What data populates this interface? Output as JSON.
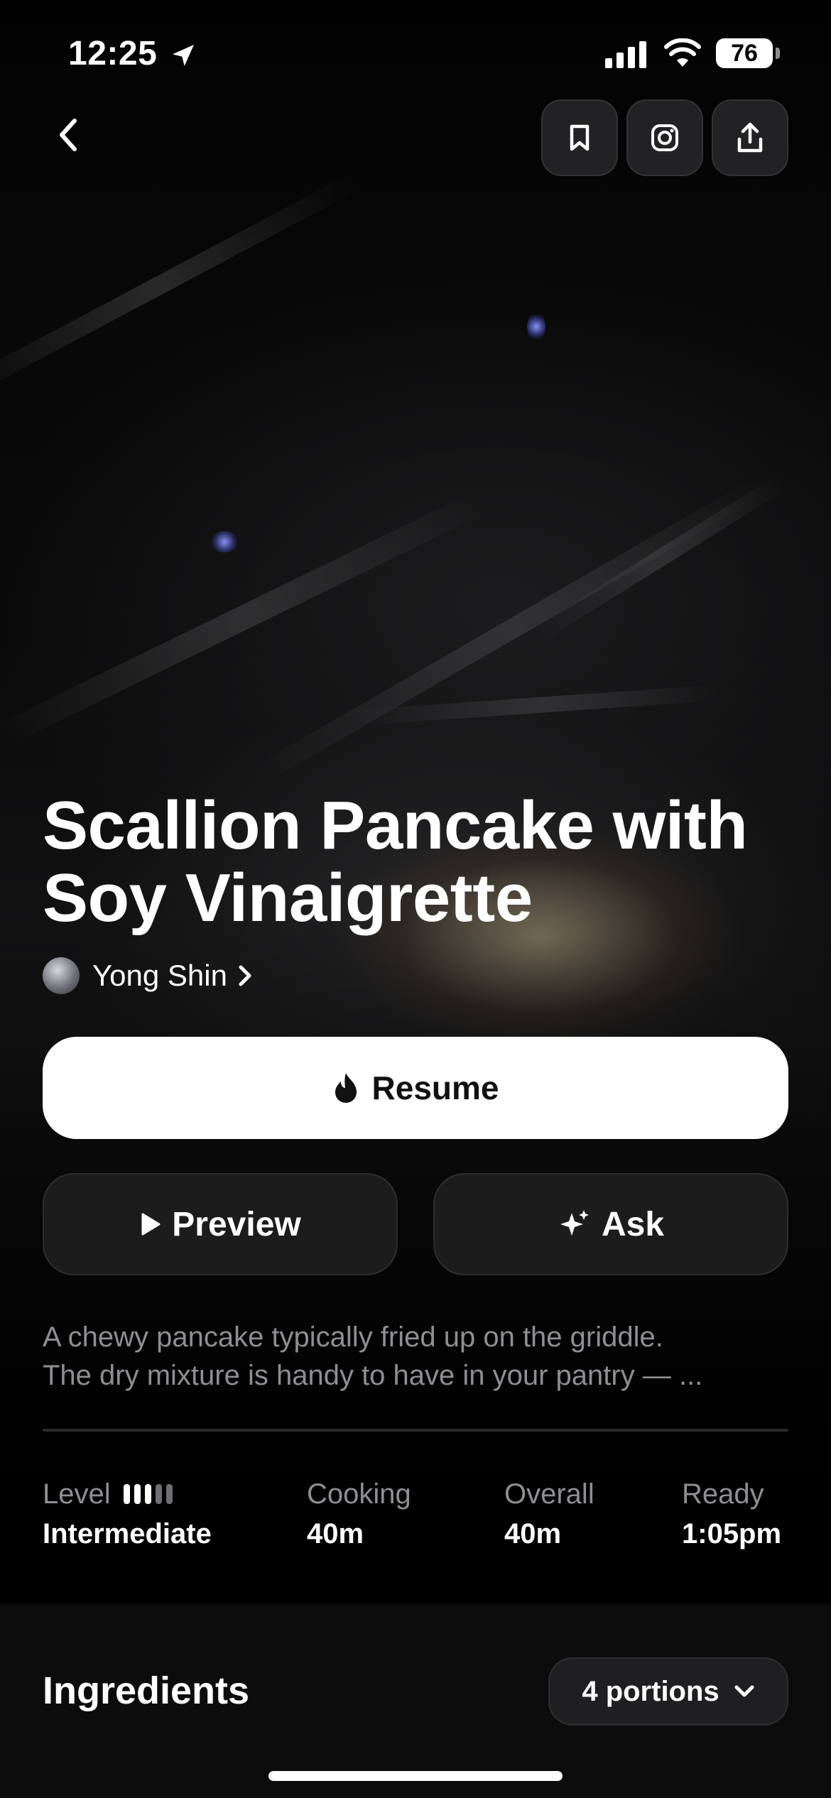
{
  "status_bar": {
    "time": "12:25",
    "battery": "76",
    "icons": [
      "location-arrow-icon",
      "cellular-signal-icon",
      "wifi-icon",
      "battery-icon"
    ]
  },
  "nav": {
    "icons": [
      "chevron-left-icon",
      "bookmark-icon",
      "instagram-icon",
      "share-icon"
    ]
  },
  "recipe": {
    "title_line1": "Scallion Pancake with",
    "title_line2": "Soy Vinaigrette",
    "author": "Yong Shin",
    "description_line1": "A chewy pancake typically fried up on the griddle.",
    "description_line2": "The dry mixture is handy to have in your pantry — ..."
  },
  "actions": {
    "resume_label": "Resume",
    "preview_label": "Preview",
    "ask_label": "Ask"
  },
  "stats": {
    "level_label": "Level",
    "level_value": "Intermediate",
    "level_filled": 3,
    "level_total": 5,
    "cooking_label": "Cooking",
    "cooking_value": "40m",
    "overall_label": "Overall",
    "overall_value": "40m",
    "ready_label": "Ready",
    "ready_value": "1:05pm"
  },
  "ingredients": {
    "title": "Ingredients",
    "portions_label": "4 portions"
  },
  "colors": {
    "background": "#000000",
    "muted_text": "#8e8e93",
    "button_dark": "#1e1e20",
    "button_light": "#ffffff"
  }
}
